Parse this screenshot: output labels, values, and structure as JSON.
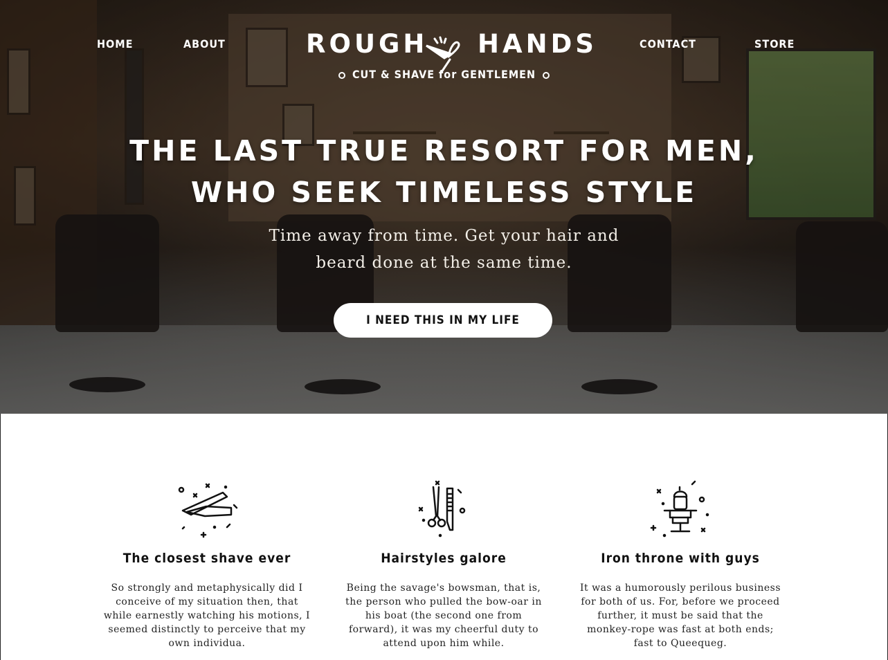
{
  "nav": {
    "home": "HOME",
    "about": "ABOUT",
    "contact": "CONTACT",
    "store": "STORE"
  },
  "logo": {
    "word_left": "ROUGH",
    "word_right": "HANDS",
    "tagline": "CUT & SHAVE for GENTLEMEN",
    "icon": "razor-icon"
  },
  "hero": {
    "headline_line1": "THE LAST TRUE RESORT FOR MEN,",
    "headline_line2": "WHO SEEK TIMELESS STYLE",
    "subtitle_line1": "Time away from time. Get your hair and",
    "subtitle_line2": "beard done at the same time.",
    "cta_label": "I NEED THIS IN MY LIFE"
  },
  "features": [
    {
      "icon": "straight-razor-icon",
      "title": "The closest shave ever",
      "text": "So strongly and metaphysically did I conceive of my situation then, that while earnestly watching his motions, I seemed distinctly to perceive that my own individua."
    },
    {
      "icon": "scissors-comb-icon",
      "title": "Hairstyles galore",
      "text": "Being the savage's bowsman, that is, the person who pulled the bow-oar in his boat (the second one from forward), it was my cheerful duty to attend upon him while."
    },
    {
      "icon": "barber-chair-icon",
      "title": "Iron throne with guys",
      "text": "It was a humorously perilous business for both of us. For, before we proceed further, it must be said that the monkey-rope was fast at both ends; fast to Queequeg."
    }
  ],
  "colors": {
    "hero_overlay": "#2e2620",
    "cta_background": "#ffffff",
    "text_dark": "#111111"
  }
}
